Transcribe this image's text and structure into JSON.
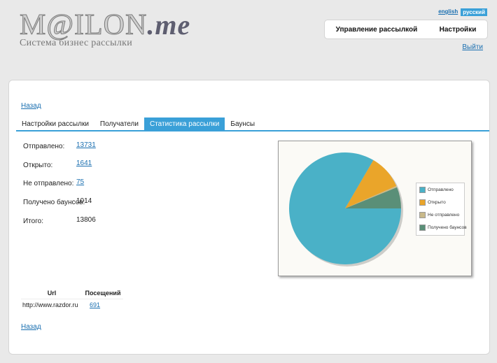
{
  "header": {
    "logo_main": "M@ILON",
    "logo_suffix": ".me",
    "logo_subtitle": "Система бизнес рассылки",
    "lang_english": "english",
    "lang_russian": "русский",
    "nav_manage": "Управление рассылкой",
    "nav_settings": "Настройки",
    "logout": "Выйти"
  },
  "main": {
    "back_top": "Назад",
    "back_bottom": "Назад",
    "tabs": [
      {
        "label": "Настройки рассылки",
        "active": false
      },
      {
        "label": "Получатели",
        "active": false
      },
      {
        "label": "Статистика рассылки",
        "active": true
      },
      {
        "label": "Баунсы",
        "active": false
      }
    ],
    "stats": [
      {
        "label": "Отправлено:",
        "value": "13731",
        "link": true
      },
      {
        "label": "Открыто:",
        "value": "1641",
        "link": true
      },
      {
        "label": "Не отправлено:",
        "value": "75",
        "link": true
      },
      {
        "label": "Получено баунсов:",
        "value": "1014",
        "link": false
      },
      {
        "label": "Итого:",
        "value": "13806",
        "link": false
      }
    ],
    "url_table": {
      "headers": [
        "Url",
        "Посещений"
      ],
      "rows": [
        {
          "url": "http://www.razdor.ru",
          "visits": "691"
        }
      ]
    }
  },
  "chart_data": {
    "type": "pie",
    "title": "",
    "slices": [
      {
        "label": "Отправлено",
        "value": 13731,
        "color": "#4ab1c7"
      },
      {
        "label": "Открыто",
        "value": 1641,
        "color": "#eaa52a"
      },
      {
        "label": "Не отправлено",
        "value": 75,
        "color": "#c9b98a"
      },
      {
        "label": "Получено баунсов",
        "value": 1014,
        "color": "#5a8f78"
      }
    ],
    "legend_position": "right"
  }
}
